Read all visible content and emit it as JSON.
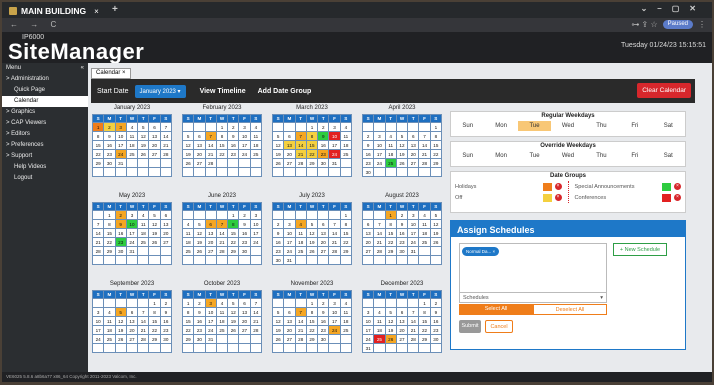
{
  "browser": {
    "tab_title": "MAIN BUILDING",
    "tab_close": "×",
    "new_tab": "+",
    "nav": "← → C",
    "paused": "Paused"
  },
  "header": {
    "model": "IP6000",
    "logo": "SiteManager",
    "datetime": "Tuesday 01/24/23 15:15:51"
  },
  "sidebar": {
    "menu_label": "Menu",
    "collapse": "«",
    "items": [
      {
        "label": "> Administration",
        "sub": false,
        "active": false
      },
      {
        "label": "Quick Page",
        "sub": true,
        "active": false
      },
      {
        "label": "Calendar",
        "sub": true,
        "active": true
      },
      {
        "label": "> Graphics",
        "sub": false,
        "active": false
      },
      {
        "label": "> CAP Viewers",
        "sub": false,
        "active": false
      },
      {
        "label": "> Editors",
        "sub": false,
        "active": false
      },
      {
        "label": "> Preferences",
        "sub": false,
        "active": false
      },
      {
        "label": "> Support",
        "sub": false,
        "active": false
      },
      {
        "label": "Help Videos",
        "sub": true,
        "active": false
      },
      {
        "label": "Logout",
        "sub": true,
        "active": false
      }
    ]
  },
  "page_tab": {
    "label": "Calendar",
    "close": "×"
  },
  "toolbar": {
    "start_date_label": "Start Date",
    "month_button": "January 2023 ▾",
    "view_timeline": "View Timeline",
    "add_date_group": "Add Date Group",
    "clear_calendar": "Clear Calendar"
  },
  "weekday_header": [
    "S",
    "M",
    "T",
    "W",
    "T",
    "F",
    "S"
  ],
  "months": [
    {
      "name": "January 2023",
      "start": 0,
      "days": 31,
      "marks": {
        "1": "today",
        "2": "yellow",
        "3": "orange",
        "24": "orange"
      }
    },
    {
      "name": "February 2023",
      "start": 3,
      "days": 28,
      "marks": {
        "7": "orange"
      }
    },
    {
      "name": "March 2023",
      "start": 3,
      "days": 31,
      "marks": {
        "7": "orange",
        "8": "yellow",
        "9": "green",
        "10": "red",
        "13": "yellow",
        "14": "yellow",
        "15": "yellow",
        "21": "yellow",
        "22": "yellow",
        "23": "orange",
        "24": "red"
      }
    },
    {
      "name": "April 2023",
      "start": 6,
      "days": 30,
      "marks": {
        "25": "green"
      }
    },
    {
      "name": "May 2023",
      "start": 1,
      "days": 31,
      "marks": {
        "2": "orange",
        "9": "orange",
        "10": "green",
        "23": "green"
      }
    },
    {
      "name": "June 2023",
      "start": 4,
      "days": 30,
      "marks": {
        "6": "orange",
        "7": "orange",
        "8": "green"
      }
    },
    {
      "name": "July 2023",
      "start": 6,
      "days": 31,
      "marks": {
        "4": "orange"
      }
    },
    {
      "name": "August 2023",
      "start": 2,
      "days": 31,
      "marks": {
        "1": "orange"
      }
    },
    {
      "name": "September 2023",
      "start": 5,
      "days": 30,
      "marks": {
        "5": "orange"
      }
    },
    {
      "name": "October 2023",
      "start": 0,
      "days": 31,
      "marks": {
        "3": "orange"
      }
    },
    {
      "name": "November 2023",
      "start": 3,
      "days": 30,
      "marks": {
        "7": "orange",
        "24": "orange"
      }
    },
    {
      "name": "December 2023",
      "start": 5,
      "days": 31,
      "marks": {
        "25": "red",
        "26": "orange"
      }
    }
  ],
  "regular_weekdays": {
    "title": "Regular Weekdays",
    "days": [
      "Sun",
      "Mon",
      "Tue",
      "Wed",
      "Thu",
      "Fri",
      "Sat"
    ],
    "selected": "Tue"
  },
  "override_weekdays": {
    "title": "Override Weekdays",
    "days": [
      "Sun",
      "Mon",
      "Tue",
      "Wed",
      "Thu",
      "Fri",
      "Sat"
    ]
  },
  "date_groups": {
    "title": "Date Groups",
    "left": [
      {
        "label": "Holidays",
        "color": "#ef7d1a"
      },
      {
        "label": "Off",
        "color": "#f4d03f"
      }
    ],
    "right": [
      {
        "label": "Special Announcements",
        "color": "#2ecc40"
      },
      {
        "label": "Conferences",
        "color": "#e22121"
      }
    ],
    "remove": "×"
  },
  "assign": {
    "title": "Assign Schedules",
    "chip": "Normal Da...",
    "chip_x": "×",
    "new_schedule": "+ New Schedule",
    "schedules_placeholder": "Schedules",
    "select_all": "Select All",
    "deselect_all": "Deselect All",
    "submit": "Submit",
    "cancel": "Cancel"
  },
  "footer": "VE6025 5.8.6 a8b6a77 x86_64 Copyright 2011-2023 Valcom, Inc."
}
